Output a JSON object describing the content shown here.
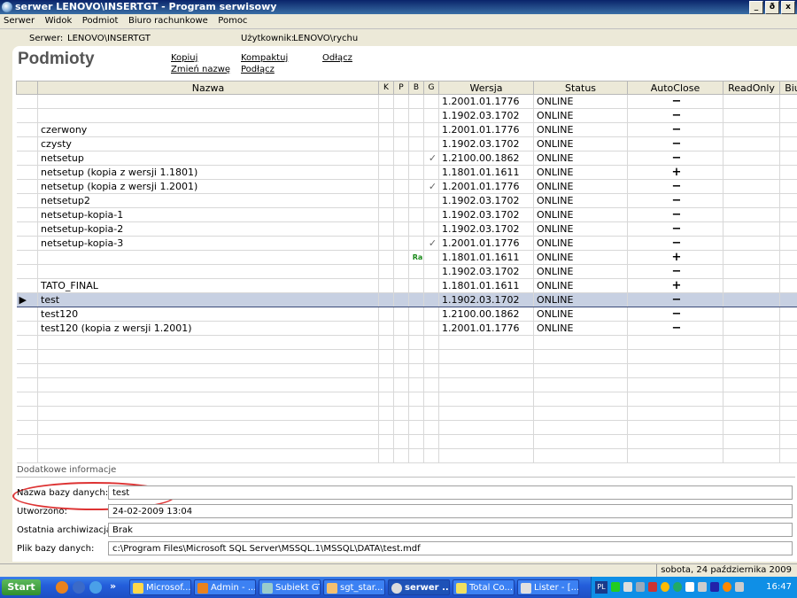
{
  "window": {
    "title": "serwer LENOVO\\INSERTGT - Program serwisowy",
    "min": "_",
    "restore": "ð",
    "close": "x"
  },
  "menu": [
    "Serwer",
    "Widok",
    "Podmiot",
    "Biuro rachunkowe",
    "Pomoc"
  ],
  "info": {
    "server_label": "Serwer:",
    "server_value": "LENOVO\\INSERTGT",
    "user_label": "Użytkownik:",
    "user_value": "LENOVO\\rychu"
  },
  "panel": {
    "title": "Podmioty",
    "links": {
      "copy": "Kopiuj",
      "rename": "Zmień nazwę",
      "compact": "Kompaktuj",
      "attach": "Podłącz",
      "detach": "Odłącz"
    }
  },
  "columns": {
    "name": "Nazwa",
    "k": "K",
    "p": "P",
    "b": "B",
    "g": "G",
    "version": "Wersja",
    "status": "Status",
    "autoclose": "AutoClose",
    "readonly": "ReadOnly",
    "biuro": "Biuro"
  },
  "rows": [
    {
      "name": "",
      "flag": "",
      "version": "1.2001.01.1776",
      "status": "ONLINE",
      "ac": "−"
    },
    {
      "name": "",
      "flag": "",
      "version": "1.1902.03.1702",
      "status": "ONLINE",
      "ac": "−"
    },
    {
      "name": "czerwony",
      "flag": "",
      "version": "1.2001.01.1776",
      "status": "ONLINE",
      "ac": "−"
    },
    {
      "name": "czysty",
      "flag": "",
      "version": "1.1902.03.1702",
      "status": "ONLINE",
      "ac": "−"
    },
    {
      "name": "netsetup",
      "flag": "✓",
      "version": "1.2100.00.1862",
      "status": "ONLINE",
      "ac": "−"
    },
    {
      "name": "netsetup (kopia z wersji 1.1801)",
      "flag": "",
      "version": "1.1801.01.1611",
      "status": "ONLINE",
      "ac": "+"
    },
    {
      "name": "netsetup (kopia z wersji 1.2001)",
      "flag": "✓",
      "version": "1.2001.01.1776",
      "status": "ONLINE",
      "ac": "−"
    },
    {
      "name": "netsetup2",
      "flag": "",
      "version": "1.1902.03.1702",
      "status": "ONLINE",
      "ac": "−"
    },
    {
      "name": "netsetup-kopia-1",
      "flag": "",
      "version": "1.1902.03.1702",
      "status": "ONLINE",
      "ac": "−"
    },
    {
      "name": "netsetup-kopia-2",
      "flag": "",
      "version": "1.1902.03.1702",
      "status": "ONLINE",
      "ac": "−"
    },
    {
      "name": "netsetup-kopia-3",
      "flag": "✓",
      "version": "1.2001.01.1776",
      "status": "ONLINE",
      "ac": "−"
    },
    {
      "name": "",
      "flag": "Ra",
      "version": "1.1801.01.1611",
      "status": "ONLINE",
      "ac": "+"
    },
    {
      "name": "",
      "flag": "",
      "version": "1.1902.03.1702",
      "status": "ONLINE",
      "ac": "−"
    },
    {
      "name": "TATO_FINAL",
      "flag": "",
      "version": "1.1801.01.1611",
      "status": "ONLINE",
      "ac": "+"
    },
    {
      "name": "test",
      "flag": "",
      "version": "1.1902.03.1702",
      "status": "ONLINE",
      "ac": "−",
      "selected": true
    },
    {
      "name": "test120",
      "flag": "",
      "version": "1.2100.00.1862",
      "status": "ONLINE",
      "ac": "−"
    },
    {
      "name": "test120 (kopia z wersji 1.2001)",
      "flag": "",
      "version": "1.2001.01.1776",
      "status": "ONLINE",
      "ac": "−"
    }
  ],
  "details": {
    "header": "Dodatkowe informacje",
    "db_name_label": "Nazwa bazy danych:",
    "db_name": "test",
    "created_label": "Utworzono:",
    "created": "24-02-2009 13:04",
    "archive_label": "Ostatnia archiwizacja:",
    "archive": "Brak",
    "file_label": "Plik bazy danych:",
    "file": "c:\\Program Files\\Microsoft SQL Server\\MSSQL.1\\MSSQL\\DATA\\test.mdf"
  },
  "status_date": "sobota, 24 października 2009",
  "taskbar": {
    "start": "Start",
    "more": "»",
    "items": [
      "Microsof...",
      "Admin - ...",
      "Subiekt GT",
      "sgt_star...",
      "serwer ...",
      "Total Co...",
      "Lister - [..."
    ],
    "lang": "PL",
    "clock": "16:47"
  }
}
